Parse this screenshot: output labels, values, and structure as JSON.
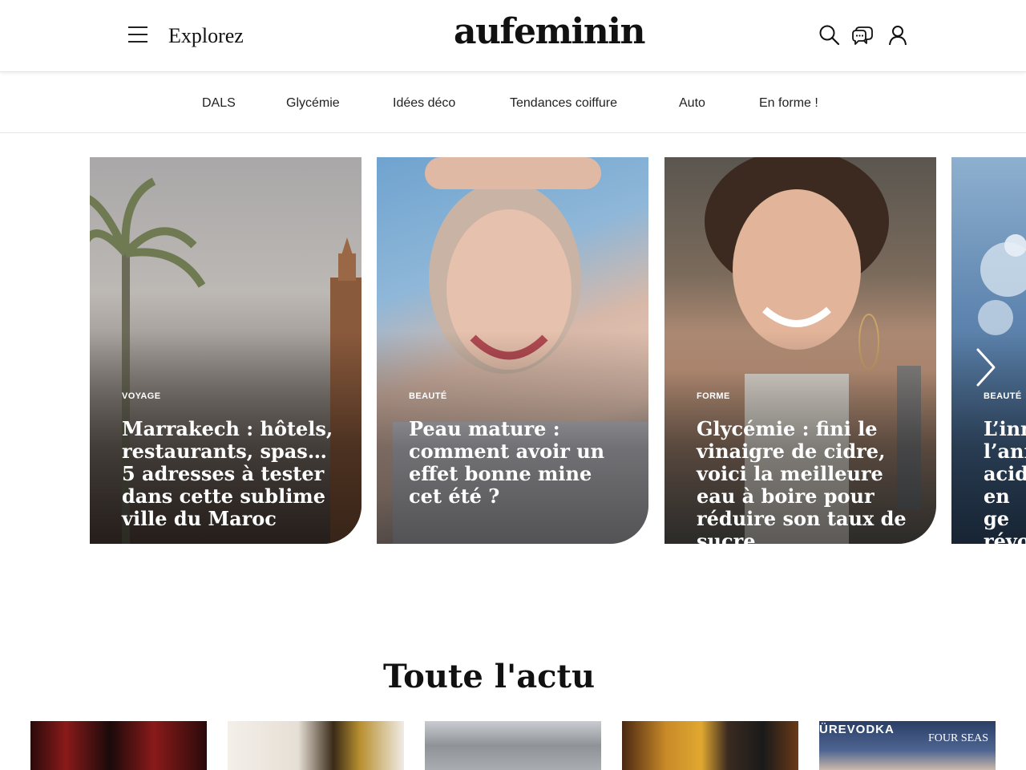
{
  "header": {
    "explore_label": "Explorez",
    "logo": "aufeminin",
    "icons": [
      "search-icon",
      "chat-icon",
      "user-icon"
    ]
  },
  "category_nav": {
    "items": [
      "DALS",
      "Glycémie",
      "Idées déco",
      "Tendances coiffure",
      "Auto",
      "En forme !"
    ]
  },
  "carousel": {
    "cards": [
      {
        "category": "VOYAGE",
        "title": "Marrakech : hôtels, restaurants, spas… 5 adresses à tester dans cette sublime ville du Maroc"
      },
      {
        "category": "BEAUTÉ",
        "title": "Peau mature : comment avoir un effet bonne mine cet été ?"
      },
      {
        "category": "FORME",
        "title": "Glycémie : fini le vinaigre de cidre, voici la meilleure eau à boire pour réduire son taux de sucre…"
      },
      {
        "category": "BEAUTÉ",
        "title": "L’inn l’ann acide en ge révo"
      }
    ]
  },
  "section": {
    "title": "Toute l'actu"
  },
  "news_thumbs": {
    "thumb5_brand": "ÜREVODKA",
    "thumb5_brand2": "FOUR SEAS"
  }
}
